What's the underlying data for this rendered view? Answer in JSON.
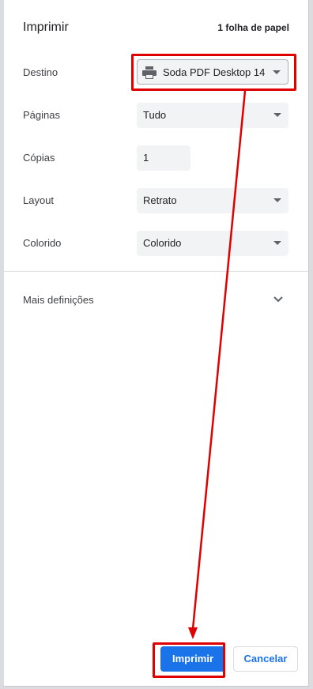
{
  "dialog": {
    "title": "Imprimir",
    "sheet_count": "1 folha de papel"
  },
  "fields": {
    "destination": {
      "label": "Destino",
      "value": "Soda PDF Desktop 14"
    },
    "pages": {
      "label": "Páginas",
      "value": "Tudo"
    },
    "copies": {
      "label": "Cópias",
      "value": "1"
    },
    "layout": {
      "label": "Layout",
      "value": "Retrato"
    },
    "color": {
      "label": "Colorido",
      "value": "Colorido"
    }
  },
  "more_settings": {
    "label": "Mais definições"
  },
  "buttons": {
    "print": "Imprimir",
    "cancel": "Cancelar"
  },
  "colors": {
    "accent": "#1a73e8",
    "annotation": "#e00000"
  }
}
